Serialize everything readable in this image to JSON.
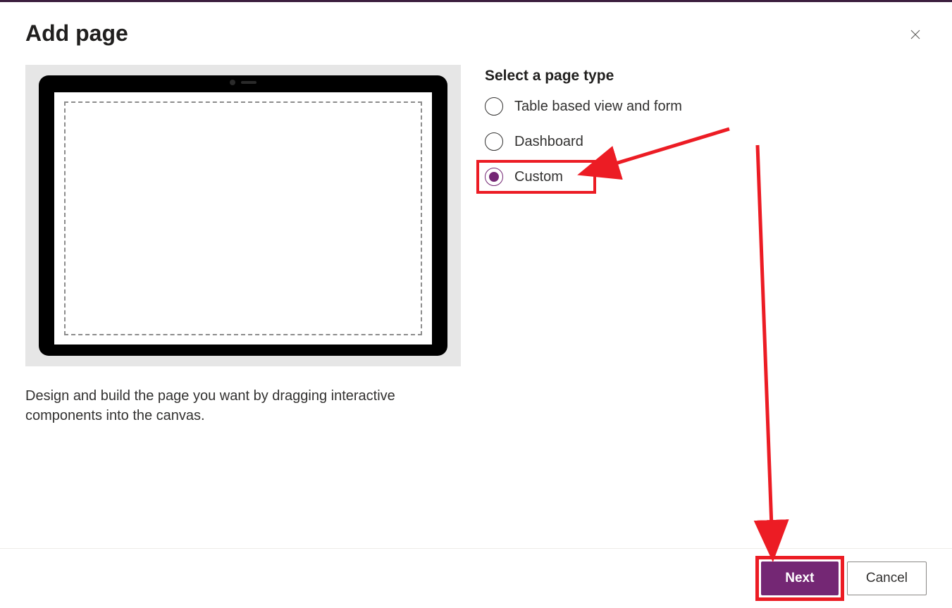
{
  "dialog": {
    "title": "Add page",
    "description": "Design and build the page you want by dragging interactive components into the canvas."
  },
  "pageType": {
    "label": "Select a page type",
    "options": [
      {
        "label": "Table based view and form",
        "selected": false
      },
      {
        "label": "Dashboard",
        "selected": false
      },
      {
        "label": "Custom",
        "selected": true
      }
    ]
  },
  "footer": {
    "primary": "Next",
    "secondary": "Cancel"
  },
  "colors": {
    "accent": "#742774",
    "annotation": "#ec1c24"
  }
}
